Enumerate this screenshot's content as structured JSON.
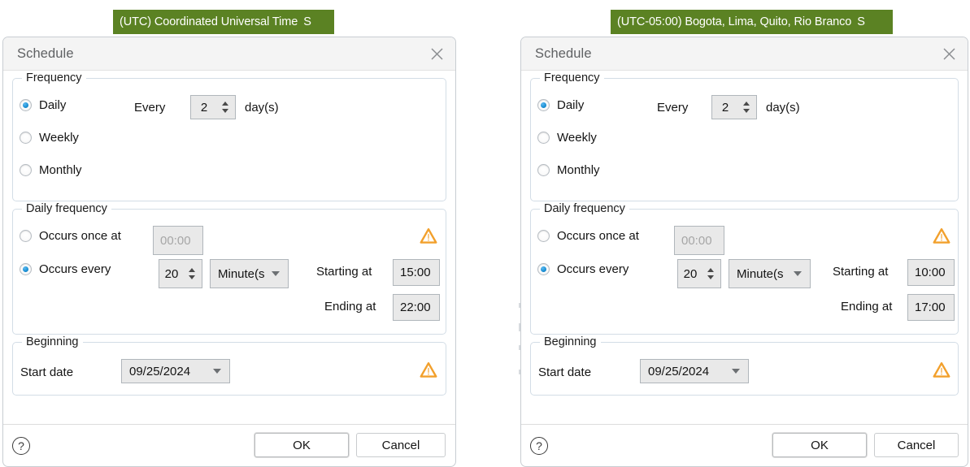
{
  "panels": [
    {
      "id": "left",
      "timezone_banner": {
        "text": "(UTC) Coordinated Universal Time",
        "trailing_clipped": "S",
        "color": "#5b8223"
      },
      "dialog": {
        "title": "Schedule",
        "close_icon": "close-icon",
        "frequency": {
          "legend": "Frequency",
          "options": [
            {
              "label": "Daily",
              "selected": true
            },
            {
              "label": "Weekly",
              "selected": false
            },
            {
              "label": "Monthly",
              "selected": false
            }
          ],
          "every_label": "Every",
          "every_value": "2",
          "unit_label": "day(s)"
        },
        "daily_frequency": {
          "legend": "Daily frequency",
          "occurs_once": {
            "label": "Occurs once at",
            "selected": false,
            "value": "00:00",
            "disabled": true
          },
          "occurs_every": {
            "label": "Occurs every",
            "selected": true,
            "interval": "20",
            "unit": "Minute(s",
            "starting_label": "Starting at",
            "starting_value": "15:00",
            "ending_label": "Ending at",
            "ending_value": "22:00"
          },
          "warning_icon": "warning-triangle-icon"
        },
        "beginning": {
          "legend": "Beginning",
          "start_date_label": "Start date",
          "start_date_value": "09/25/2024",
          "warning_icon": "warning-triangle-icon"
        },
        "footer": {
          "help_icon": "?",
          "ok_label": "OK",
          "cancel_label": "Cancel"
        }
      }
    },
    {
      "id": "right",
      "timezone_banner": {
        "text": "(UTC-05:00) Bogota, Lima, Quito, Rio Branco",
        "trailing_clipped": "S",
        "color": "#5b8223"
      },
      "dialog": {
        "title": "Schedule",
        "close_icon": "close-icon",
        "frequency": {
          "legend": "Frequency",
          "options": [
            {
              "label": "Daily",
              "selected": true
            },
            {
              "label": "Weekly",
              "selected": false
            },
            {
              "label": "Monthly",
              "selected": false
            }
          ],
          "every_label": "Every",
          "every_value": "2",
          "unit_label": "day(s)"
        },
        "daily_frequency": {
          "legend": "Daily frequency",
          "occurs_once": {
            "label": "Occurs once at",
            "selected": false,
            "value": "00:00",
            "disabled": true
          },
          "occurs_every": {
            "label": "Occurs every",
            "selected": true,
            "interval": "20",
            "unit": "Minute(s",
            "starting_label": "Starting at",
            "starting_value": "10:00",
            "ending_label": "Ending at",
            "ending_value": "17:00"
          },
          "warning_icon": "warning-triangle-icon"
        },
        "beginning": {
          "legend": "Beginning",
          "start_date_label": "Start date",
          "start_date_value": "09/25/2024",
          "warning_icon": "warning-triangle-icon"
        },
        "footer": {
          "help_icon": "?",
          "ok_label": "OK",
          "cancel_label": "Cancel"
        }
      }
    }
  ],
  "colors": {
    "banner_green": "#5b8223",
    "warning_amber": "#f2a02c",
    "radio_blue": "#1a8fd4",
    "field_grey": "#e9e9e9"
  }
}
